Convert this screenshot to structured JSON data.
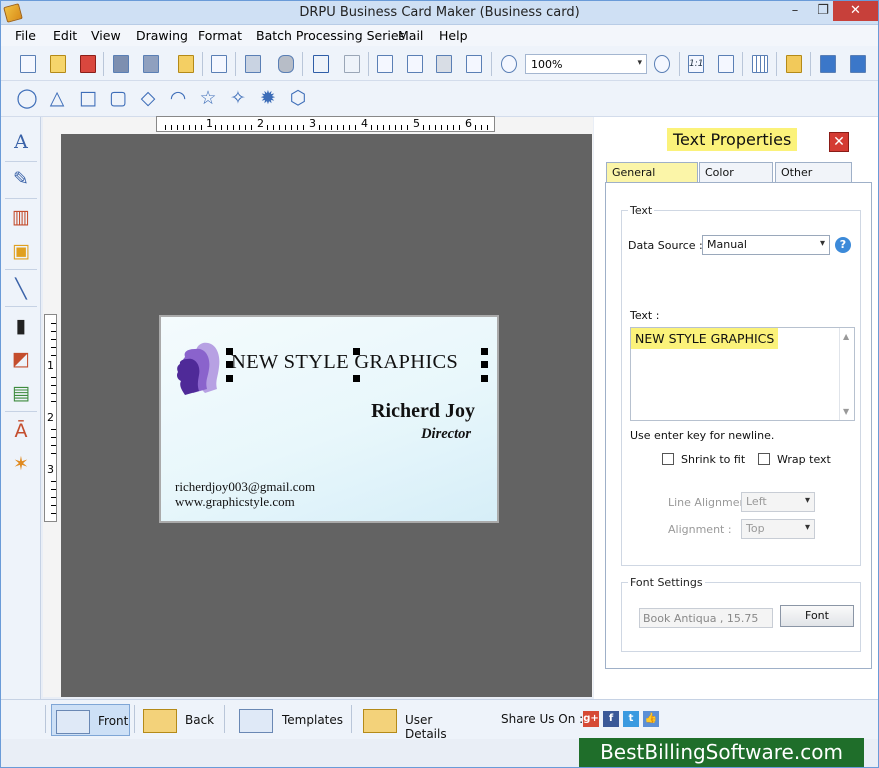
{
  "window": {
    "title": "DRPU Business Card Maker (Business card)",
    "minimize": "–",
    "maximize": "❐",
    "close": "✕"
  },
  "menu": [
    "File",
    "Edit",
    "View",
    "Drawing",
    "Format",
    "Batch Processing Series",
    "Mail",
    "Help"
  ],
  "toolbar": {
    "zoom_value": "100%",
    "zoom_arrow": "▾",
    "actual_size_label": "1:1"
  },
  "ruler": {
    "h_numbers": [
      "1",
      "2",
      "3",
      "4",
      "5",
      "6"
    ],
    "v_numbers": [
      "1",
      "2",
      "3"
    ]
  },
  "card": {
    "company": "NEW STYLE GRAPHICS",
    "name": "Richerd Joy",
    "title": "Director",
    "email": "richerdjoy003@gmail.com",
    "website": "www.graphicstyle.com"
  },
  "panel": {
    "title": "Text Properties",
    "close": "✕",
    "tabs": [
      "General Settings",
      "Color Settings",
      "Other Settings"
    ],
    "text_group": "Text",
    "data_source_label": "Data Source :",
    "data_source_value": "Manual",
    "help": "?",
    "text_label": "Text :",
    "text_value": "NEW STYLE GRAPHICS",
    "hint": "Use enter key for newline.",
    "shrink_label": "Shrink to fit",
    "wrap_label": "Wrap text",
    "line_alignment_label": "Line Alignment",
    "line_alignment_value": "Left",
    "alignment_label": "Alignment :",
    "alignment_value": "Top",
    "font_group": "Font Settings",
    "font_value": "Book Antiqua , 15.75",
    "font_button": "Font"
  },
  "bottom": {
    "buttons": [
      "Front",
      "Back",
      "Templates",
      "User Details"
    ],
    "share_label": "Share Us On :"
  },
  "brand": "BestBillingSoftware.com"
}
